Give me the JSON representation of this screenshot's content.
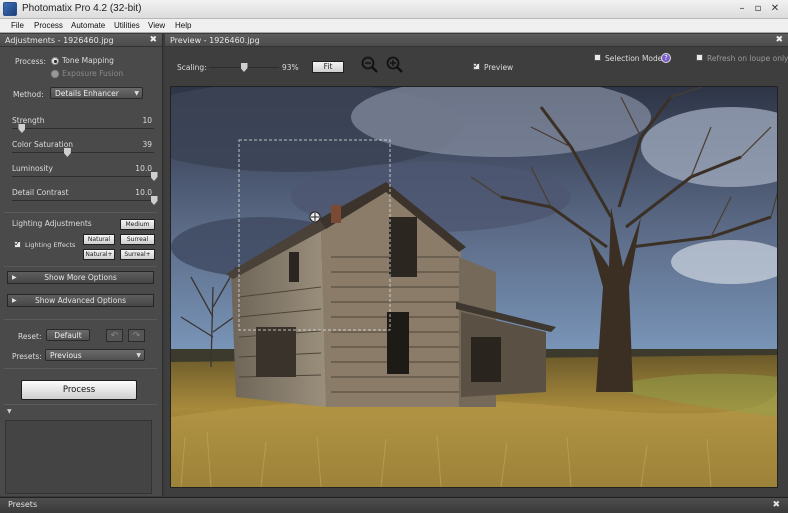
{
  "window": {
    "title": "Photomatix Pro 4.2 (32-bit)",
    "controls": {
      "minimize": "–",
      "maximize": "▫",
      "close": "✕"
    }
  },
  "menu": [
    "File",
    "Process",
    "Automate",
    "Utilities",
    "View",
    "Help"
  ],
  "adjustments": {
    "header": "Adjustments - 1926460.jpg",
    "process_label": "Process:",
    "process_options": [
      "Tone Mapping",
      "Exposure Fusion"
    ],
    "process_selected": "Tone Mapping",
    "method_label": "Method:",
    "method_value": "Details Enhancer",
    "sliders": [
      {
        "label": "Strength",
        "value": "10",
        "fraction": 0.07
      },
      {
        "label": "Color Saturation",
        "value": "39",
        "fraction": 0.39
      },
      {
        "label": "Luminosity",
        "value": "10.0",
        "fraction": 1.0
      },
      {
        "label": "Detail Contrast",
        "value": "10.0",
        "fraction": 1.0
      }
    ],
    "lighting_label": "Lighting Adjustments",
    "lighting_effects_label": "Lighting Effects",
    "lighting_effects_checked": true,
    "lighting_buttons": [
      "Medium",
      "Natural",
      "Surreal",
      "Natural+",
      "Surreal+"
    ],
    "show_more": "Show More Options",
    "show_advanced": "Show Advanced Options",
    "reset_label": "Reset:",
    "reset_value": "Default",
    "presets_label": "Presets:",
    "presets_value": "Previous",
    "process_button": "Process"
  },
  "preview": {
    "header": "Preview - 1926460.jpg",
    "scaling_label": "Scaling:",
    "scaling_value": "93%",
    "scaling_fraction": 0.93,
    "fit_button": "Fit",
    "preview_label": "Preview",
    "preview_checked": true,
    "selection_mode_label": "Selection Mode",
    "help_icon": "?",
    "refresh_label": "Refresh on loupe only"
  },
  "bottom": {
    "presets_label": "Presets"
  },
  "colors": {
    "panel": "#4a4a4a",
    "sky": "#5d7fa8",
    "grass": "#a88a3c"
  }
}
